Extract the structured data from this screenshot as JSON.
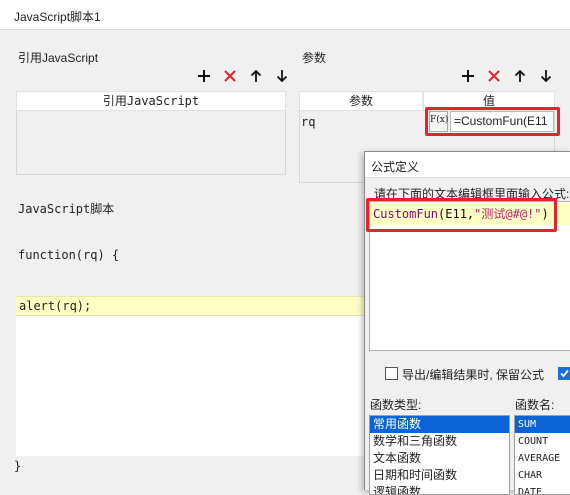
{
  "window": {
    "title": "JavaScript脚本1"
  },
  "reference": {
    "label": "引用JavaScript",
    "column_header": "引用JavaScript"
  },
  "params": {
    "label": "参数",
    "col_name": "参数",
    "col_value": "值",
    "row_name": "rq",
    "fx_label": "F(x)",
    "value": "=CustomFun(E11"
  },
  "script": {
    "label": "JavaScript脚本",
    "signature": "function(rq) {",
    "body_line": "alert(rq);",
    "closing": "}"
  },
  "dialog": {
    "title": "公式定义",
    "instruction": "请在下面的文本编辑框里面输入公式:",
    "formula_fn": "CustomFun",
    "formula_args": "(E11,",
    "formula_str": "\"测试@#@!\"",
    "formula_end": ")",
    "keep_formula_label": "导出/编辑结果时, 保留公式",
    "keep_formula_checked": false,
    "second_checked": true,
    "func_type_label": "函数类型:",
    "func_name_label": "函数名:",
    "func_types": [
      "常用函数",
      "数学和三角函数",
      "文本函数",
      "日期和时间函数",
      "逻辑函数"
    ],
    "func_names": [
      "SUM",
      "COUNT",
      "AVERAGE",
      "CHAR",
      "DATE"
    ]
  },
  "colors": {
    "accent_red": "#e8222a",
    "selection_blue": "#0a64d6",
    "highlight_yellow": "#ffffc4"
  }
}
